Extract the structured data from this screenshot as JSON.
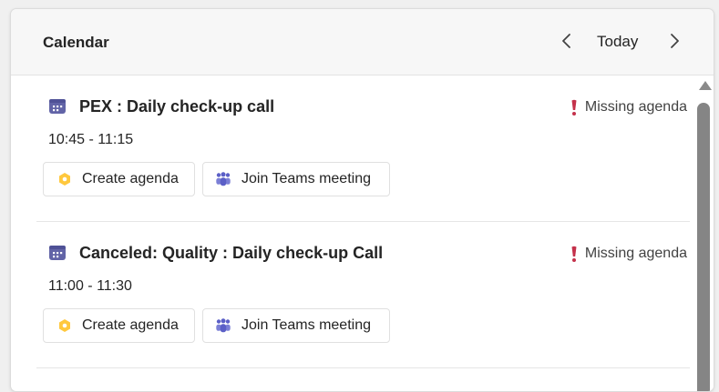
{
  "header": {
    "title": "Calendar",
    "today_label": "Today",
    "prev_icon": "chevron-left-icon",
    "next_icon": "chevron-right-icon"
  },
  "events": [
    {
      "title": "PEX : Daily check-up call",
      "time": "10:45 - 11:15",
      "warning": "Missing agenda",
      "create_agenda_label": "Create agenda",
      "join_label": "Join Teams meeting"
    },
    {
      "title": "Canceled: Quality : Daily check-up Call",
      "time": "11:00 - 11:30",
      "warning": "Missing agenda",
      "create_agenda_label": "Create agenda",
      "join_label": "Join Teams meeting"
    }
  ],
  "colors": {
    "calendar_icon": "#6264a7",
    "warning_icon": "#c4314b",
    "agenda_icon": "#ffc83d",
    "teams_icon": "#5b5fc7",
    "scrollbar": "#858585"
  }
}
